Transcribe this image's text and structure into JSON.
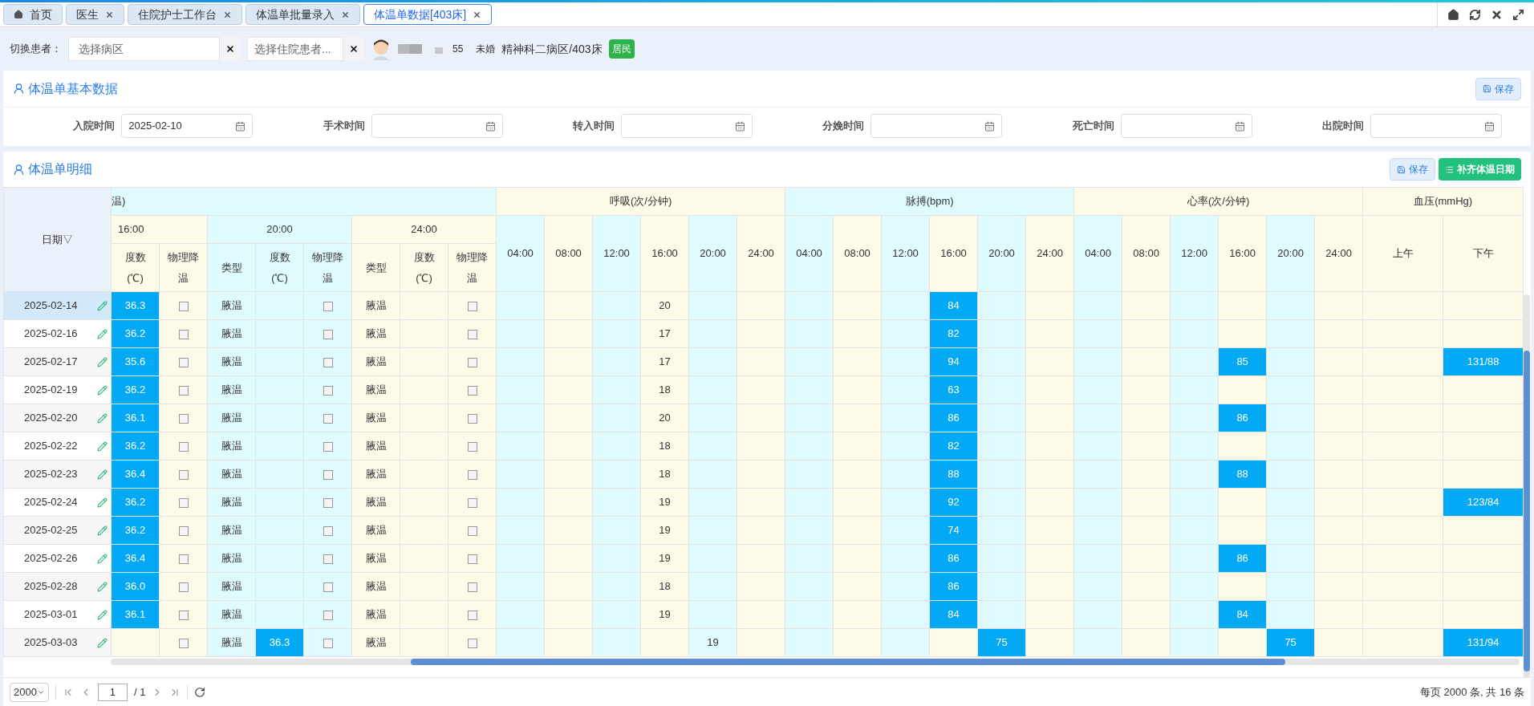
{
  "tabs": [
    {
      "label": "首页",
      "kind": "home",
      "selected": false
    },
    {
      "label": "医生",
      "kind": "closable",
      "selected": false
    },
    {
      "label": "住院护士工作台",
      "kind": "closable",
      "selected": false
    },
    {
      "label": "体温单批量录入",
      "kind": "closable",
      "selected": false
    },
    {
      "label": "体温单数据[403床]",
      "kind": "closable",
      "selected": true
    }
  ],
  "patient_bar": {
    "label": "切换患者：",
    "ward_select": {
      "placeholder": "选择病区"
    },
    "patient_select": {
      "placeholder": "选择住院患者..."
    },
    "age": "55",
    "marital_status": "未婚",
    "location": "精神科二病区/403床",
    "badge": "居民"
  },
  "basic_data": {
    "title": "体温单基本数据",
    "save_button": "保存",
    "fields": [
      {
        "label": "入院时间",
        "value": "2025-02-10"
      },
      {
        "label": "手术时间"
      },
      {
        "label": "转入时间"
      },
      {
        "label": "分娩时间"
      },
      {
        "label": "死亡时间"
      },
      {
        "label": "出院时间"
      }
    ]
  },
  "detail": {
    "title": "体温单明细",
    "save_button": "保存",
    "fill_dates_button": "补齐体温日期",
    "table": {
      "date_header": "日期▽",
      "temperature_group": {
        "label": "温)",
        "times": [
          {
            "label": "16:00",
            "columns": [
              "度数(℃)",
              "物理降温"
            ]
          },
          {
            "label": "20:00",
            "columns": [
              "类型",
              "度数(℃)",
              "物理降温"
            ]
          },
          {
            "label": "24:00",
            "columns": [
              "类型",
              "度数(℃)",
              "物理降温"
            ]
          }
        ]
      },
      "vital_groups": [
        {
          "label": "呼吸(次/分钟)",
          "times": [
            "04:00",
            "08:00",
            "12:00",
            "16:00",
            "20:00",
            "24:00"
          ]
        },
        {
          "label": "脉搏(bpm)",
          "times": [
            "04:00",
            "08:00",
            "12:00",
            "16:00",
            "20:00",
            "24:00"
          ]
        },
        {
          "label": "心率(次/分钟)",
          "times": [
            "04:00",
            "08:00",
            "12:00",
            "16:00",
            "20:00",
            "24:00"
          ]
        },
        {
          "label": "血压(mmHg)",
          "times": [
            "上午",
            "下午"
          ]
        }
      ],
      "rows": [
        {
          "date": "2025-02-14",
          "selected": true,
          "temperature": [
            {
              "value": "36.3",
              "highlighted": true,
              "cooling_checked": false
            },
            {
              "type": "腋温",
              "highlighted": false,
              "cooling_checked": false
            },
            {
              "type": "腋温",
              "highlighted": false,
              "cooling_checked": false
            }
          ],
          "vitals": [
            [
              {
                "highlighted": false
              },
              {
                "highlighted": false
              },
              {
                "highlighted": false
              },
              {
                "value": "20",
                "highlighted": false
              },
              {
                "highlighted": false
              },
              {
                "highlighted": false
              }
            ],
            [
              {
                "highlighted": false
              },
              {
                "highlighted": false
              },
              {
                "highlighted": false
              },
              {
                "value": "84",
                "highlighted": true
              },
              {
                "highlighted": false
              },
              {
                "highlighted": false
              }
            ],
            [
              {
                "highlighted": false
              },
              {
                "highlighted": false
              },
              {
                "highlighted": false
              },
              {
                "highlighted": false
              },
              {
                "highlighted": false
              },
              {
                "highlighted": false
              }
            ],
            [
              {
                "highlighted": false
              },
              {
                "highlighted": false
              }
            ]
          ]
        },
        {
          "date": "2025-02-16",
          "selected": false,
          "temperature": [
            {
              "value": "36.2",
              "highlighted": true,
              "cooling_checked": false
            },
            {
              "type": "腋温",
              "highlighted": false,
              "cooling_checked": false
            },
            {
              "type": "腋温",
              "highlighted": false,
              "cooling_checked": false
            }
          ],
          "vitals": [
            [
              {
                "highlighted": false
              },
              {
                "highlighted": false
              },
              {
                "highlighted": false
              },
              {
                "value": "17",
                "highlighted": false
              },
              {
                "highlighted": false
              },
              {
                "highlighted": false
              }
            ],
            [
              {
                "highlighted": false
              },
              {
                "highlighted": false
              },
              {
                "highlighted": false
              },
              {
                "value": "82",
                "highlighted": true
              },
              {
                "highlighted": false
              },
              {
                "highlighted": false
              }
            ],
            [
              {
                "highlighted": false
              },
              {
                "highlighted": false
              },
              {
                "highlighted": false
              },
              {
                "highlighted": false
              },
              {
                "highlighted": false
              },
              {
                "highlighted": false
              }
            ],
            [
              {
                "highlighted": false
              },
              {
                "highlighted": false
              }
            ]
          ]
        },
        {
          "date": "2025-02-17",
          "selected": false,
          "temperature": [
            {
              "value": "35.6",
              "highlighted": true,
              "cooling_checked": false
            },
            {
              "type": "腋温",
              "highlighted": false,
              "cooling_checked": false
            },
            {
              "type": "腋温",
              "highlighted": false,
              "cooling_checked": false
            }
          ],
          "vitals": [
            [
              {
                "highlighted": false
              },
              {
                "highlighted": false
              },
              {
                "highlighted": false
              },
              {
                "value": "17",
                "highlighted": false
              },
              {
                "highlighted": false
              },
              {
                "highlighted": false
              }
            ],
            [
              {
                "highlighted": false
              },
              {
                "highlighted": false
              },
              {
                "highlighted": false
              },
              {
                "value": "94",
                "highlighted": true
              },
              {
                "highlighted": false
              },
              {
                "highlighted": false
              }
            ],
            [
              {
                "highlighted": false
              },
              {
                "highlighted": false
              },
              {
                "highlighted": false
              },
              {
                "value": "85",
                "highlighted": true
              },
              {
                "highlighted": false
              },
              {
                "highlighted": false
              }
            ],
            [
              {
                "highlighted": false
              },
              {
                "value": "131/88",
                "highlighted": true
              }
            ]
          ]
        },
        {
          "date": "2025-02-19",
          "selected": false,
          "temperature": [
            {
              "value": "36.2",
              "highlighted": true,
              "cooling_checked": false
            },
            {
              "type": "腋温",
              "highlighted": false,
              "cooling_checked": false
            },
            {
              "type": "腋温",
              "highlighted": false,
              "cooling_checked": false
            }
          ],
          "vitals": [
            [
              {
                "highlighted": false
              },
              {
                "highlighted": false
              },
              {
                "highlighted": false
              },
              {
                "value": "18",
                "highlighted": false
              },
              {
                "highlighted": false
              },
              {
                "highlighted": false
              }
            ],
            [
              {
                "highlighted": false
              },
              {
                "highlighted": false
              },
              {
                "highlighted": false
              },
              {
                "value": "63",
                "highlighted": true
              },
              {
                "highlighted": false
              },
              {
                "highlighted": false
              }
            ],
            [
              {
                "highlighted": false
              },
              {
                "highlighted": false
              },
              {
                "highlighted": false
              },
              {
                "highlighted": false
              },
              {
                "highlighted": false
              },
              {
                "highlighted": false
              }
            ],
            [
              {
                "highlighted": false
              },
              {
                "highlighted": false
              }
            ]
          ]
        },
        {
          "date": "2025-02-20",
          "selected": false,
          "temperature": [
            {
              "value": "36.1",
              "highlighted": true,
              "cooling_checked": false
            },
            {
              "type": "腋温",
              "highlighted": false,
              "cooling_checked": false
            },
            {
              "type": "腋温",
              "highlighted": false,
              "cooling_checked": false
            }
          ],
          "vitals": [
            [
              {
                "highlighted": false
              },
              {
                "highlighted": false
              },
              {
                "highlighted": false
              },
              {
                "value": "20",
                "highlighted": false
              },
              {
                "highlighted": false
              },
              {
                "highlighted": false
              }
            ],
            [
              {
                "highlighted": false
              },
              {
                "highlighted": false
              },
              {
                "highlighted": false
              },
              {
                "value": "86",
                "highlighted": true
              },
              {
                "highlighted": false
              },
              {
                "highlighted": false
              }
            ],
            [
              {
                "highlighted": false
              },
              {
                "highlighted": false
              },
              {
                "highlighted": false
              },
              {
                "value": "86",
                "highlighted": true
              },
              {
                "highlighted": false
              },
              {
                "highlighted": false
              }
            ],
            [
              {
                "highlighted": false
              },
              {
                "highlighted": false
              }
            ]
          ]
        },
        {
          "date": "2025-02-22",
          "selected": false,
          "temperature": [
            {
              "value": "36.2",
              "highlighted": true,
              "cooling_checked": false
            },
            {
              "type": "腋温",
              "highlighted": false,
              "cooling_checked": false
            },
            {
              "type": "腋温",
              "highlighted": false,
              "cooling_checked": false
            }
          ],
          "vitals": [
            [
              {
                "highlighted": false
              },
              {
                "highlighted": false
              },
              {
                "highlighted": false
              },
              {
                "value": "18",
                "highlighted": false
              },
              {
                "highlighted": false
              },
              {
                "highlighted": false
              }
            ],
            [
              {
                "highlighted": false
              },
              {
                "highlighted": false
              },
              {
                "highlighted": false
              },
              {
                "value": "82",
                "highlighted": true
              },
              {
                "highlighted": false
              },
              {
                "highlighted": false
              }
            ],
            [
              {
                "highlighted": false
              },
              {
                "highlighted": false
              },
              {
                "highlighted": false
              },
              {
                "highlighted": false
              },
              {
                "highlighted": false
              },
              {
                "highlighted": false
              }
            ],
            [
              {
                "highlighted": false
              },
              {
                "highlighted": false
              }
            ]
          ]
        },
        {
          "date": "2025-02-23",
          "selected": false,
          "temperature": [
            {
              "value": "36.4",
              "highlighted": true,
              "cooling_checked": false
            },
            {
              "type": "腋温",
              "highlighted": false,
              "cooling_checked": false
            },
            {
              "type": "腋温",
              "highlighted": false,
              "cooling_checked": false
            }
          ],
          "vitals": [
            [
              {
                "highlighted": false
              },
              {
                "highlighted": false
              },
              {
                "highlighted": false
              },
              {
                "value": "18",
                "highlighted": false
              },
              {
                "highlighted": false
              },
              {
                "highlighted": false
              }
            ],
            [
              {
                "highlighted": false
              },
              {
                "highlighted": false
              },
              {
                "highlighted": false
              },
              {
                "value": "88",
                "highlighted": true
              },
              {
                "highlighted": false
              },
              {
                "highlighted": false
              }
            ],
            [
              {
                "highlighted": false
              },
              {
                "highlighted": false
              },
              {
                "highlighted": false
              },
              {
                "value": "88",
                "highlighted": true
              },
              {
                "highlighted": false
              },
              {
                "highlighted": false
              }
            ],
            [
              {
                "highlighted": false
              },
              {
                "highlighted": false
              }
            ]
          ]
        },
        {
          "date": "2025-02-24",
          "selected": false,
          "temperature": [
            {
              "value": "36.2",
              "highlighted": true,
              "cooling_checked": false
            },
            {
              "type": "腋温",
              "highlighted": false,
              "cooling_checked": false
            },
            {
              "type": "腋温",
              "highlighted": false,
              "cooling_checked": false
            }
          ],
          "vitals": [
            [
              {
                "highlighted": false
              },
              {
                "highlighted": false
              },
              {
                "highlighted": false
              },
              {
                "value": "19",
                "highlighted": false
              },
              {
                "highlighted": false
              },
              {
                "highlighted": false
              }
            ],
            [
              {
                "highlighted": false
              },
              {
                "highlighted": false
              },
              {
                "highlighted": false
              },
              {
                "value": "92",
                "highlighted": true
              },
              {
                "highlighted": false
              },
              {
                "highlighted": false
              }
            ],
            [
              {
                "highlighted": false
              },
              {
                "highlighted": false
              },
              {
                "highlighted": false
              },
              {
                "highlighted": false
              },
              {
                "highlighted": false
              },
              {
                "highlighted": false
              }
            ],
            [
              {
                "highlighted": false
              },
              {
                "value": "123/84",
                "highlighted": true
              }
            ]
          ]
        },
        {
          "date": "2025-02-25",
          "selected": false,
          "temperature": [
            {
              "value": "36.2",
              "highlighted": true,
              "cooling_checked": false
            },
            {
              "type": "腋温",
              "highlighted": false,
              "cooling_checked": false
            },
            {
              "type": "腋温",
              "highlighted": false,
              "cooling_checked": false
            }
          ],
          "vitals": [
            [
              {
                "highlighted": false
              },
              {
                "highlighted": false
              },
              {
                "highlighted": false
              },
              {
                "value": "19",
                "highlighted": false
              },
              {
                "highlighted": false
              },
              {
                "highlighted": false
              }
            ],
            [
              {
                "highlighted": false
              },
              {
                "highlighted": false
              },
              {
                "highlighted": false
              },
              {
                "value": "74",
                "highlighted": true
              },
              {
                "highlighted": false
              },
              {
                "highlighted": false
              }
            ],
            [
              {
                "highlighted": false
              },
              {
                "highlighted": false
              },
              {
                "highlighted": false
              },
              {
                "highlighted": false
              },
              {
                "highlighted": false
              },
              {
                "highlighted": false
              }
            ],
            [
              {
                "highlighted": false
              },
              {
                "highlighted": false
              }
            ]
          ]
        },
        {
          "date": "2025-02-26",
          "selected": false,
          "temperature": [
            {
              "value": "36.4",
              "highlighted": true,
              "cooling_checked": false
            },
            {
              "type": "腋温",
              "highlighted": false,
              "cooling_checked": false
            },
            {
              "type": "腋温",
              "highlighted": false,
              "cooling_checked": false
            }
          ],
          "vitals": [
            [
              {
                "highlighted": false
              },
              {
                "highlighted": false
              },
              {
                "highlighted": false
              },
              {
                "value": "19",
                "highlighted": false
              },
              {
                "highlighted": false
              },
              {
                "highlighted": false
              }
            ],
            [
              {
                "highlighted": false
              },
              {
                "highlighted": false
              },
              {
                "highlighted": false
              },
              {
                "value": "86",
                "highlighted": true
              },
              {
                "highlighted": false
              },
              {
                "highlighted": false
              }
            ],
            [
              {
                "highlighted": false
              },
              {
                "highlighted": false
              },
              {
                "highlighted": false
              },
              {
                "value": "86",
                "highlighted": true
              },
              {
                "highlighted": false
              },
              {
                "highlighted": false
              }
            ],
            [
              {
                "highlighted": false
              },
              {
                "highlighted": false
              }
            ]
          ]
        },
        {
          "date": "2025-02-28",
          "selected": false,
          "temperature": [
            {
              "value": "36.0",
              "highlighted": true,
              "cooling_checked": false
            },
            {
              "type": "腋温",
              "highlighted": false,
              "cooling_checked": false
            },
            {
              "type": "腋温",
              "highlighted": false,
              "cooling_checked": false
            }
          ],
          "vitals": [
            [
              {
                "highlighted": false
              },
              {
                "highlighted": false
              },
              {
                "highlighted": false
              },
              {
                "value": "18",
                "highlighted": false
              },
              {
                "highlighted": false
              },
              {
                "highlighted": false
              }
            ],
            [
              {
                "highlighted": false
              },
              {
                "highlighted": false
              },
              {
                "highlighted": false
              },
              {
                "value": "86",
                "highlighted": true
              },
              {
                "highlighted": false
              },
              {
                "highlighted": false
              }
            ],
            [
              {
                "highlighted": false
              },
              {
                "highlighted": false
              },
              {
                "highlighted": false
              },
              {
                "highlighted": false
              },
              {
                "highlighted": false
              },
              {
                "highlighted": false
              }
            ],
            [
              {
                "highlighted": false
              },
              {
                "highlighted": false
              }
            ]
          ]
        },
        {
          "date": "2025-03-01",
          "selected": false,
          "temperature": [
            {
              "value": "36.1",
              "highlighted": true,
              "cooling_checked": false
            },
            {
              "type": "腋温",
              "highlighted": false,
              "cooling_checked": false
            },
            {
              "type": "腋温",
              "highlighted": false,
              "cooling_checked": false
            }
          ],
          "vitals": [
            [
              {
                "highlighted": false
              },
              {
                "highlighted": false
              },
              {
                "highlighted": false
              },
              {
                "value": "19",
                "highlighted": false
              },
              {
                "highlighted": false
              },
              {
                "highlighted": false
              }
            ],
            [
              {
                "highlighted": false
              },
              {
                "highlighted": false
              },
              {
                "highlighted": false
              },
              {
                "value": "84",
                "highlighted": true
              },
              {
                "highlighted": false
              },
              {
                "highlighted": false
              }
            ],
            [
              {
                "highlighted": false
              },
              {
                "highlighted": false
              },
              {
                "highlighted": false
              },
              {
                "value": "84",
                "highlighted": true
              },
              {
                "highlighted": false
              },
              {
                "highlighted": false
              }
            ],
            [
              {
                "highlighted": false
              },
              {
                "highlighted": false
              }
            ]
          ]
        },
        {
          "date": "2025-03-03",
          "selected": false,
          "temperature": [
            {
              "highlighted": false,
              "cooling_checked": false
            },
            {
              "type": "腋温",
              "value": "36.3",
              "highlighted": true,
              "cooling_checked": false
            },
            {
              "type": "腋温",
              "highlighted": false,
              "cooling_checked": false
            }
          ],
          "vitals": [
            [
              {
                "highlighted": false
              },
              {
                "highlighted": false
              },
              {
                "highlighted": false
              },
              {
                "highlighted": false
              },
              {
                "value": "19",
                "highlighted": false
              },
              {
                "highlighted": false
              }
            ],
            [
              {
                "highlighted": false
              },
              {
                "highlighted": false
              },
              {
                "highlighted": false
              },
              {
                "highlighted": false
              },
              {
                "value": "75",
                "highlighted": true
              },
              {
                "highlighted": false
              }
            ],
            [
              {
                "highlighted": false
              },
              {
                "highlighted": false
              },
              {
                "highlighted": false
              },
              {
                "highlighted": false
              },
              {
                "value": "75",
                "highlighted": true
              },
              {
                "highlighted": false
              }
            ],
            [
              {
                "highlighted": false
              },
              {
                "value": "131/94",
                "highlighted": true
              }
            ]
          ]
        }
      ]
    }
  },
  "pagination": {
    "page_size": "2000",
    "page": "1",
    "total_pages": "/ 1",
    "summary": "每页 2000 条, 共 16 条"
  }
}
